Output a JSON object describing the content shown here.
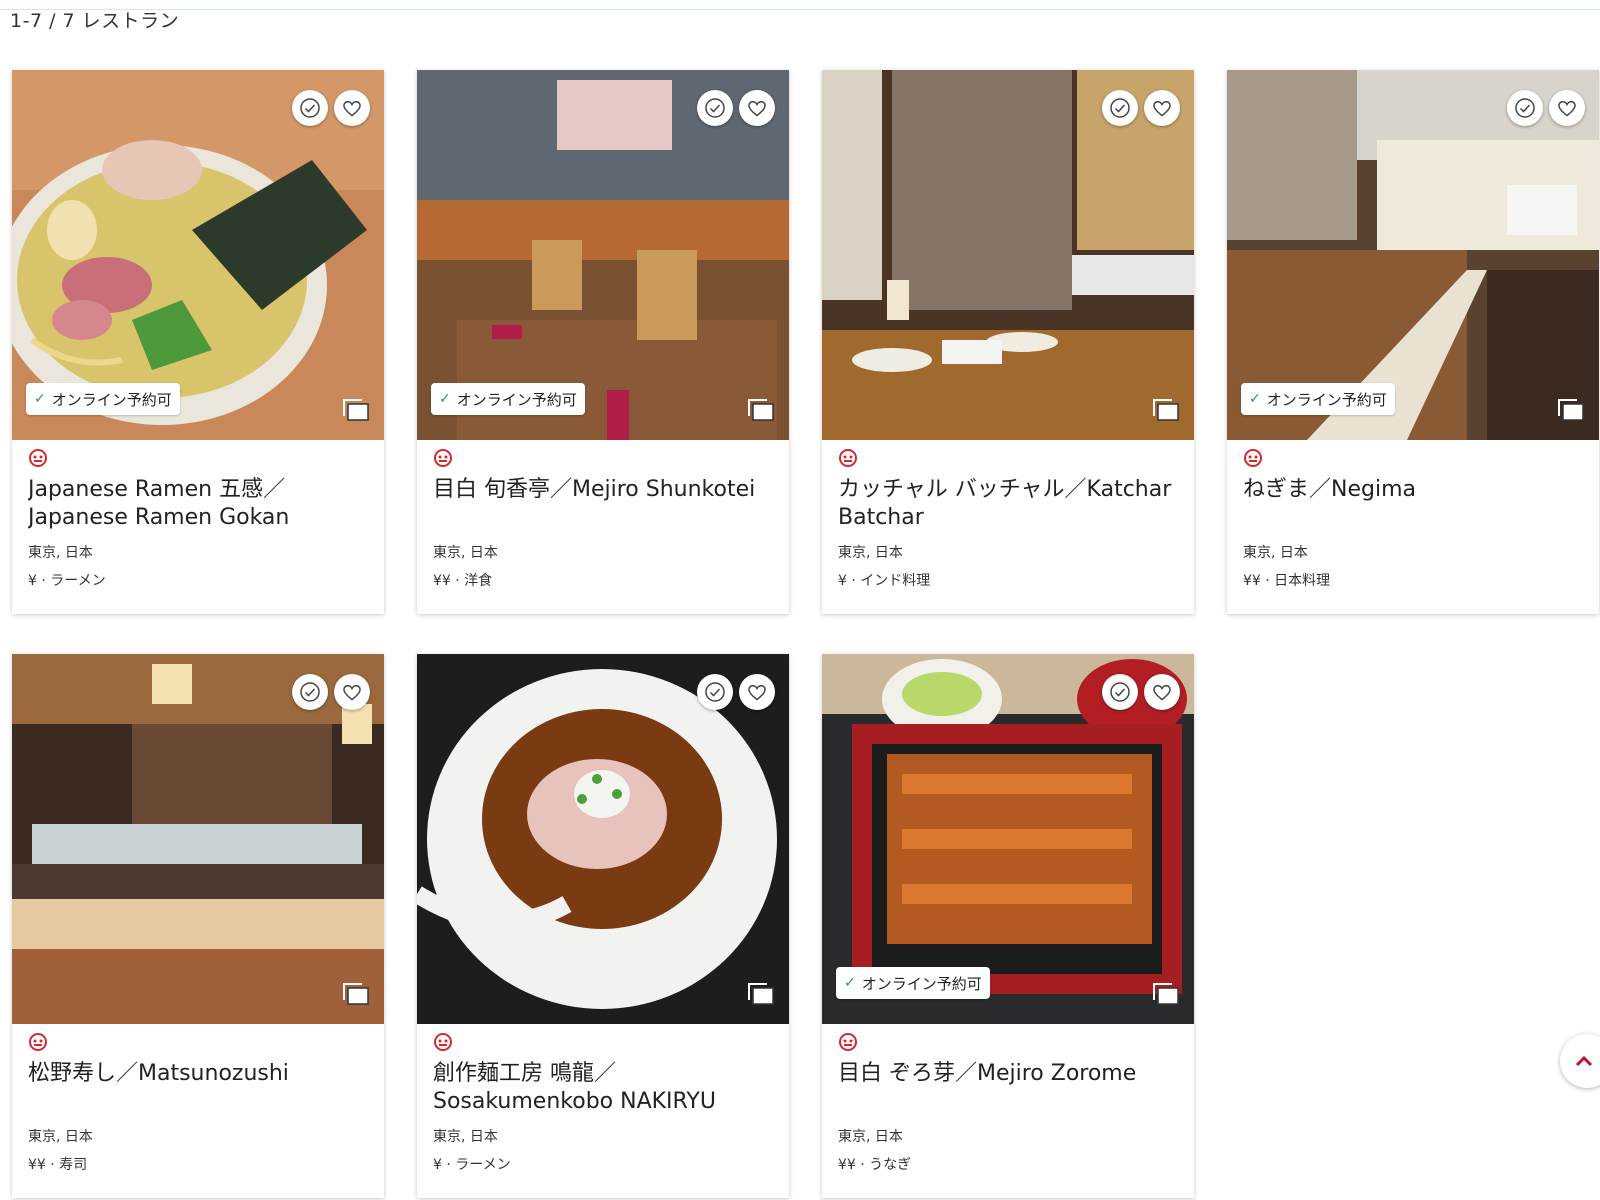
{
  "results": {
    "count_label": "1-7 / 7 レストラン"
  },
  "badge_label": "オンライン予約可",
  "colors": {
    "logo_red": "#d7282f",
    "check_green": "#1a9a55",
    "scroll_arrow": "#c8102e"
  },
  "icons": {
    "visited": "check-circle-icon",
    "favorite": "heart-icon",
    "gallery": "gallery-icon",
    "logo": "restaurant-logo-icon",
    "scroll": "chevron-up-icon"
  },
  "restaurants": [
    {
      "name": "Japanese Ramen 五感／Japanese Ramen Gokan",
      "location": "東京, 日本",
      "price_cuisine": "¥ · ラーメン",
      "online_reservation": true
    },
    {
      "name": "目白 旬香亭／Mejiro Shunkotei",
      "location": "東京, 日本",
      "price_cuisine": "¥¥ · 洋食",
      "online_reservation": true
    },
    {
      "name": "カッチャル バッチャル／Katchar Batchar",
      "location": "東京, 日本",
      "price_cuisine": "¥ · インド料理",
      "online_reservation": false
    },
    {
      "name": "ねぎま／Negima",
      "location": "東京, 日本",
      "price_cuisine": "¥¥ · 日本料理",
      "online_reservation": true
    },
    {
      "name": "松野寿し／Matsunozushi",
      "location": "東京, 日本",
      "price_cuisine": "¥¥ · 寿司",
      "online_reservation": false
    },
    {
      "name": "創作麺工房 鳴龍／Sosakumenkobo NAKIRYU",
      "location": "東京, 日本",
      "price_cuisine": "¥ · ラーメン",
      "online_reservation": false
    },
    {
      "name": "目白 ぞろ芽／Mejiro Zorome",
      "location": "東京, 日本",
      "price_cuisine": "¥¥ · うなぎ",
      "online_reservation": true
    }
  ]
}
